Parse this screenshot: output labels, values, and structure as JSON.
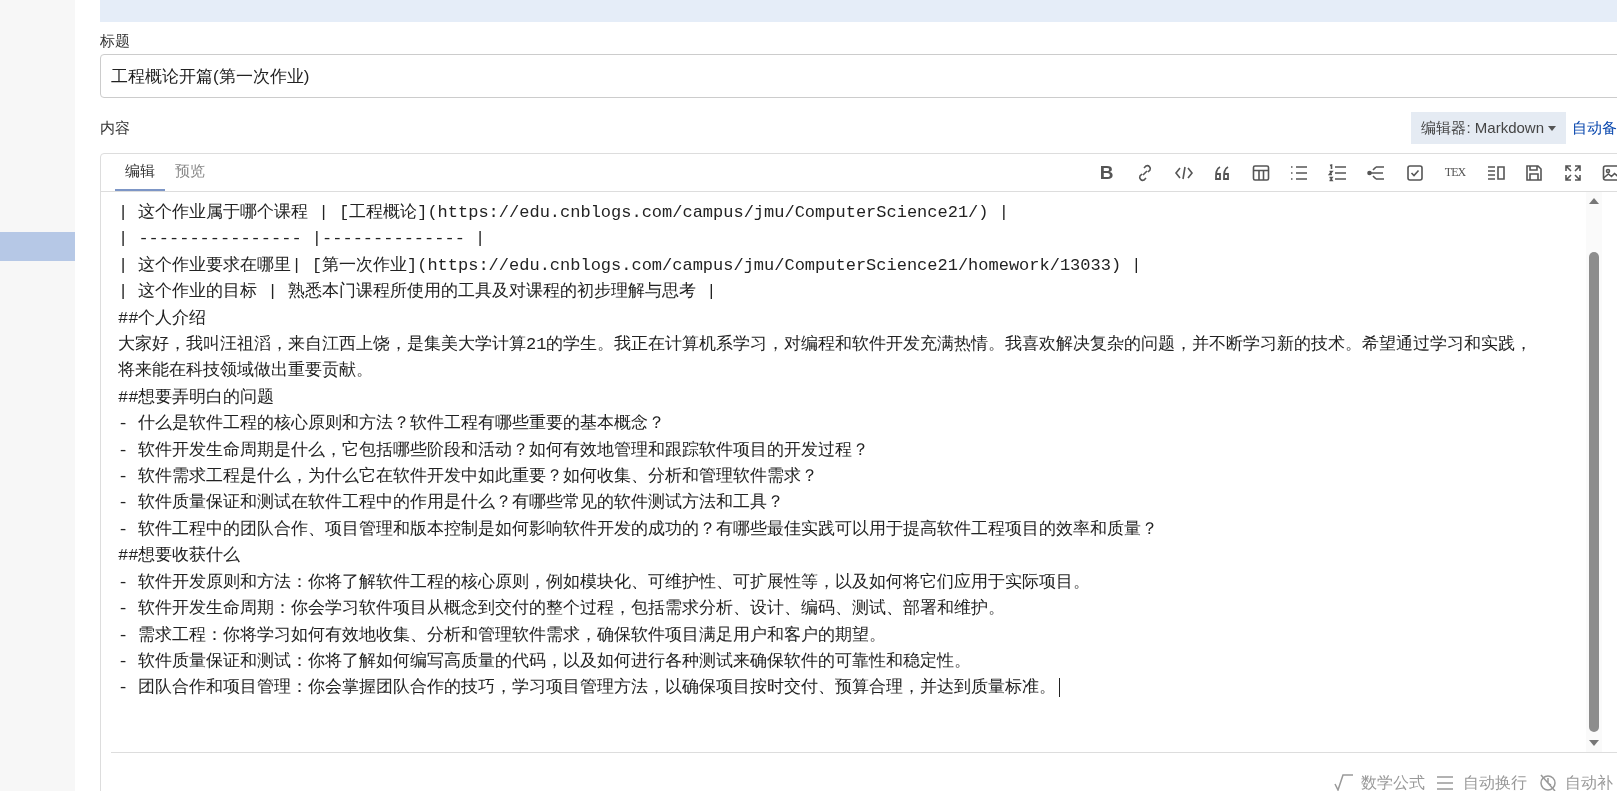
{
  "title_field": {
    "label": "标题",
    "value": "工程概论开篇(第一次作业)"
  },
  "content": {
    "label": "内容",
    "editor_select": "编辑器: Markdown",
    "autosave_link": "自动备"
  },
  "editor": {
    "tabs": [
      {
        "label": "编辑",
        "selected": true
      },
      {
        "label": "预览",
        "selected": false
      }
    ],
    "toolbar": {
      "bold": "B",
      "typeset_label": "TEX"
    },
    "lines": [
      "| 这个作业属于哪个课程 | [工程概论](https://edu.cnblogs.com/campus/jmu/ComputerScience21/) |",
      "| ---------------- |-------------- |",
      "| 这个作业要求在哪里| [第一次作业](https://edu.cnblogs.com/campus/jmu/ComputerScience21/homework/13033) |",
      "| 这个作业的目标 | 熟悉本门课程所使用的工具及对课程的初步理解与思考 |",
      "##个人介绍",
      "大家好，我叫汪祖滔，来自江西上饶，是集美大学计算21的学生。我正在计算机系学习，对编程和软件开发充满热情。我喜欢解决复杂的问题，并不断学习新的技术。希望通过学习和实践，",
      "将来能在科技领域做出重要贡献。",
      "##想要弄明白的问题",
      "- 什么是软件工程的核心原则和方法？软件工程有哪些重要的基本概念？",
      "- 软件开发生命周期是什么，它包括哪些阶段和活动？如何有效地管理和跟踪软件项目的开发过程？",
      "- 软件需求工程是什么，为什么它在软件开发中如此重要？如何收集、分析和管理软件需求？",
      "- 软件质量保证和测试在软件工程中的作用是什么？有哪些常见的软件测试方法和工具？",
      "- 软件工程中的团队合作、项目管理和版本控制是如何影响软件开发的成功的？有哪些最佳实践可以用于提高软件工程项目的效率和质量？",
      "##想要收获什么",
      "- 软件开发原则和方法：你将了解软件工程的核心原则，例如模块化、可维护性、可扩展性等，以及如何将它们应用于实际项目。",
      "- 软件开发生命周期：你会学习软件项目从概念到交付的整个过程，包括需求分析、设计、编码、测试、部署和维护。",
      "- 需求工程：你将学习如何有效地收集、分析和管理软件需求，确保软件项目满足用户和客户的期望。",
      "- 软件质量保证和测试：你将了解如何编写高质量的代码，以及如何进行各种测试来确保软件的可靠性和稳定性。",
      "- 团队合作和项目管理：你会掌握团队合作的技巧，学习项目管理方法，以确保项目按时交付、预算合理，并达到质量标准。"
    ]
  },
  "status_bar": [
    {
      "label": "数学公式"
    },
    {
      "label": "自动换行"
    },
    {
      "label": "自动补"
    }
  ]
}
